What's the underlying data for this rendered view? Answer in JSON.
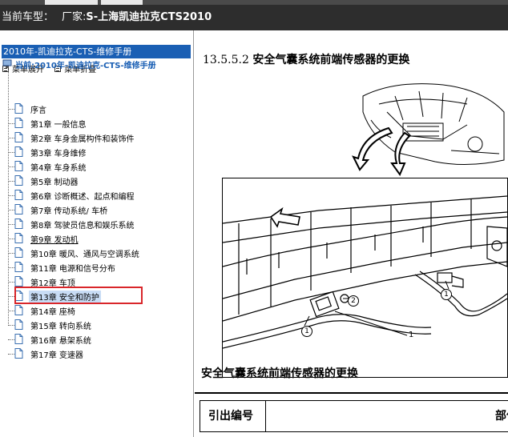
{
  "header": {
    "vehicle_label": "当前车型：",
    "maker_label": "厂家:",
    "maker_value": "S-上海凯迪拉克CTS2010"
  },
  "sidebar": {
    "manual_title": "2010年-凯迪拉克-CTS-维修手册",
    "expand_label": "菜单展开",
    "collapse_label": "菜单折叠",
    "root_label": "当前:2010年-凯迪拉克-CTS-维修手册",
    "items": [
      {
        "label": "序言"
      },
      {
        "label": "第1章  一般信息"
      },
      {
        "label": "第2章  车身金属构件和装饰件"
      },
      {
        "label": "第3章  车身维修"
      },
      {
        "label": "第4章  车身系统"
      },
      {
        "label": "第5章  制动器"
      },
      {
        "label": "第6章  诊断概述、起点和编程"
      },
      {
        "label": "第7章  传动系统/ 车桥"
      },
      {
        "label": "第8章  驾驶员信息和娱乐系统"
      },
      {
        "label": "第9章  发动机"
      },
      {
        "label": "第10章  暖风、通风与空调系统"
      },
      {
        "label": "第11章  电源和信号分布"
      },
      {
        "label": "第12章  车顶"
      },
      {
        "label": "第13章  安全和防护"
      },
      {
        "label": "第14章  座椅"
      },
      {
        "label": "第15章  转向系统"
      },
      {
        "label": "第16章  悬架系统"
      },
      {
        "label": "第17章  变速器"
      }
    ],
    "selected_index": 13
  },
  "content": {
    "section_number": "13.5.5.2",
    "section_title": "安全气囊系统前端传感器的更换",
    "figure_title": "安全气囊系统前端传感器的更换",
    "callouts": [
      "1",
      "2",
      "1"
    ],
    "leader_label": "1",
    "table_headers": [
      "引出编号",
      "部件"
    ]
  },
  "colors": {
    "header_bg": "#2d2d2d",
    "title_bar": "#1a5fb4",
    "root_text": "#1a5fb4",
    "highlight_box": "#d9262a"
  }
}
